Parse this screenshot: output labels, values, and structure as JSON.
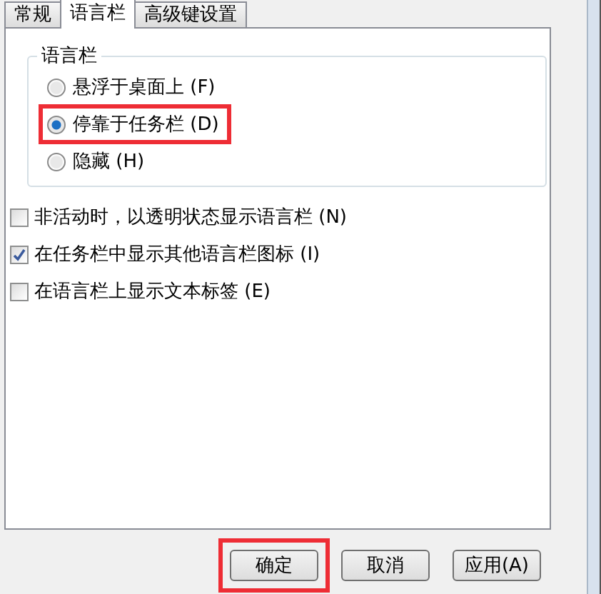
{
  "tabs": [
    {
      "label": "常规",
      "selected": false
    },
    {
      "label": "语言栏",
      "selected": true
    },
    {
      "label": "高级键设置",
      "selected": false
    }
  ],
  "group": {
    "title": "语言栏",
    "options": [
      {
        "label": "悬浮于桌面上 (F)",
        "selected": false,
        "highlighted": false
      },
      {
        "label": "停靠于任务栏 (D)",
        "selected": true,
        "highlighted": true
      },
      {
        "label": "隐藏 (H)",
        "selected": false,
        "highlighted": false
      }
    ]
  },
  "checkboxes": [
    {
      "label": "非活动时，以透明状态显示语言栏 (N)",
      "checked": false
    },
    {
      "label": "在任务栏中显示其他语言栏图标 (I)",
      "checked": true
    },
    {
      "label": "在语言栏上显示文本标签 (E)",
      "checked": false
    }
  ],
  "buttons": [
    {
      "label": "确定",
      "highlighted": true
    },
    {
      "label": "取消",
      "highlighted": false
    },
    {
      "label": "应用(A)",
      "highlighted": false
    }
  ]
}
